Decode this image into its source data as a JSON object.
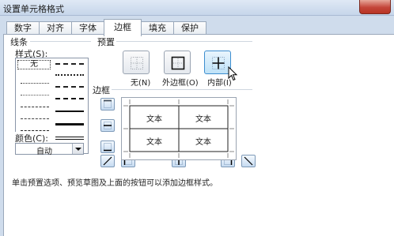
{
  "window": {
    "title": "设置单元格格式"
  },
  "tabs": [
    {
      "label": "数字"
    },
    {
      "label": "对齐"
    },
    {
      "label": "字体"
    },
    {
      "label": "边框",
      "active": true
    },
    {
      "label": "填充"
    },
    {
      "label": "保护"
    }
  ],
  "line": {
    "group_label": "线条",
    "style_label": "样式(S):",
    "none_label": "无",
    "color_label": "颜色(C):",
    "color_value": "自动"
  },
  "presets": {
    "group_label": "预置",
    "items": [
      {
        "label": "无(N)",
        "icon": "no-border-icon"
      },
      {
        "label": "外边框(O)",
        "icon": "outline-icon"
      },
      {
        "label": "内部(I)",
        "icon": "inside-border-icon",
        "active": true
      }
    ]
  },
  "border": {
    "group_label": "边框",
    "preview_cells": [
      "文本",
      "文本",
      "文本",
      "文本"
    ]
  },
  "hint_text": "单击预置选项、预览草图及上面的按钮可以添加边框样式。",
  "colors": {
    "accent": "#3d8ecf",
    "panel": "#ffffff",
    "frame": "#cfdcec"
  }
}
